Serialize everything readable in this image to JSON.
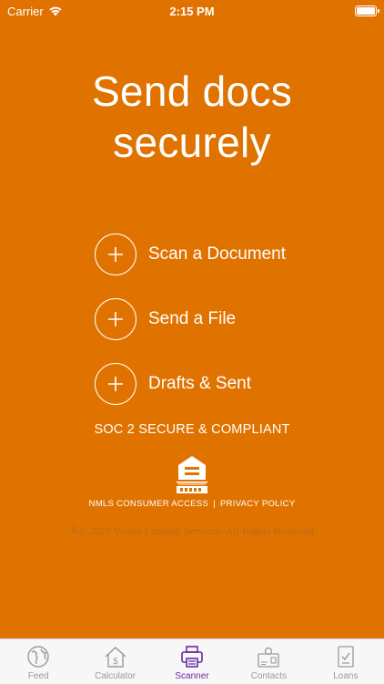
{
  "status": {
    "carrier": "Carrier",
    "time": "2:15 PM",
    "battery_level": 1.0
  },
  "headline": {
    "line1": "Send docs",
    "line2": "securely"
  },
  "actions": [
    {
      "label": "Scan a Document",
      "icon": "plus-icon"
    },
    {
      "label": "Send a File",
      "icon": "plus-icon"
    },
    {
      "label": "Drafts & Sent",
      "icon": "plus-icon"
    }
  ],
  "compliance": "SOC 2 SECURE & COMPLIANT",
  "equal_housing_logo_text": "EQUAL OPPORTUNITY LENDER",
  "links": {
    "nmls": "NMLS CONSUMER ACCESS",
    "separator": "|",
    "privacy": "PRIVACY POLICY"
  },
  "copyright": "Â© 2020 Vision Lending Services. All Rights Reserved",
  "tabs": [
    {
      "label": "Feed",
      "icon": "globe-icon",
      "active": false
    },
    {
      "label": "Calculator",
      "icon": "house-dollar-icon",
      "active": false
    },
    {
      "label": "Scanner",
      "icon": "printer-icon",
      "active": true
    },
    {
      "label": "Contacts",
      "icon": "contact-card-icon",
      "active": false
    },
    {
      "label": "Loans",
      "icon": "document-check-icon",
      "active": false
    }
  ],
  "colors": {
    "background": "#e07200",
    "active_tab": "#6a2aa0",
    "inactive_tab": "#9a9a9a",
    "tab_bar": "#f7f7f7"
  }
}
